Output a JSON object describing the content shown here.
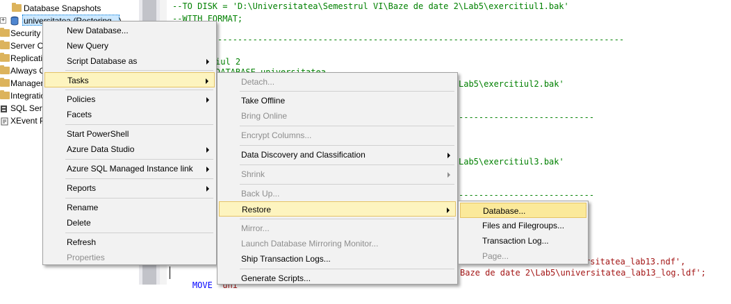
{
  "explorer": {
    "items": [
      {
        "label": "Database Snapshots",
        "kind": "folder",
        "expander": "+"
      },
      {
        "label": "universitatea (Restoring...)",
        "kind": "database",
        "expander": "+"
      },
      {
        "label": "Security",
        "kind": "folder"
      },
      {
        "label": "Server Objects",
        "kind": "folder"
      },
      {
        "label": "Replication",
        "kind": "folder"
      },
      {
        "label": "Always On High Availability",
        "kind": "folder"
      },
      {
        "label": "Management",
        "kind": "folder"
      },
      {
        "label": "Integration Services Catalogs",
        "kind": "folder"
      },
      {
        "label": "SQL Server Agent",
        "kind": "agent",
        "expander": "+"
      },
      {
        "label": "XEvent Profiler",
        "kind": "profiler"
      }
    ]
  },
  "editor": {
    "lines": [
      {
        "text": "--TO DISK = 'D:\\Universitatea\\Semestrul VI\\Baze de date 2\\Lab5\\exercitiul1.bak'",
        "color": "green"
      },
      {
        "text": "--WITH FORMAT;",
        "color": "green"
      },
      {
        "text": "------------------------------------------------------------------------------------------",
        "color": "green"
      },
      {
        "text": "iul 2",
        "color": "green"
      },
      {
        "text": "DATABASE universitatea",
        "color": "green"
      },
      {
        "text": "Lab5\\exercitiul2.bak'",
        "color": "green"
      },
      {
        "text": "---------------------------",
        "color": "green"
      },
      {
        "text": "Lab5\\exercitiul3.bak'",
        "color": "green"
      },
      {
        "text": "---------------------------",
        "color": "green"
      },
      {
        "text": "rsitatea_lab13.ndf',",
        "color": "red"
      },
      {
        "text": "MOVE 'uni",
        "color": "mixed"
      },
      {
        "text": "Baze de date 2\\Lab5\\universitatea_lab13_log.ldf';",
        "color": "red"
      }
    ]
  },
  "menus": {
    "main": [
      {
        "label": "New Database..."
      },
      {
        "label": "New Query"
      },
      {
        "label": "Script Database as",
        "submenu": true
      },
      {
        "sep": true
      },
      {
        "label": "Tasks",
        "submenu": true,
        "highlighted": true
      },
      {
        "sep": true
      },
      {
        "label": "Policies",
        "submenu": true
      },
      {
        "label": "Facets"
      },
      {
        "sep": true
      },
      {
        "label": "Start PowerShell"
      },
      {
        "label": "Azure Data Studio",
        "submenu": true
      },
      {
        "sep": true
      },
      {
        "label": "Azure SQL Managed Instance link",
        "submenu": true
      },
      {
        "sep": true
      },
      {
        "label": "Reports",
        "submenu": true
      },
      {
        "sep": true
      },
      {
        "label": "Rename"
      },
      {
        "label": "Delete"
      },
      {
        "sep": true
      },
      {
        "label": "Refresh"
      },
      {
        "label": "Properties",
        "disabled": true
      }
    ],
    "tasks": [
      {
        "label": "Detach...",
        "disabled": true
      },
      {
        "sep": true
      },
      {
        "label": "Take Offline"
      },
      {
        "label": "Bring Online",
        "disabled": true
      },
      {
        "sep": true
      },
      {
        "label": "Encrypt Columns...",
        "disabled": true
      },
      {
        "sep": true
      },
      {
        "label": "Data Discovery and Classification",
        "submenu": true
      },
      {
        "sep": true
      },
      {
        "label": "Shrink",
        "submenu": true,
        "disabled": true
      },
      {
        "sep": true
      },
      {
        "label": "Back Up...",
        "disabled": true
      },
      {
        "label": "Restore",
        "submenu": true,
        "highlighted": true
      },
      {
        "sep": true
      },
      {
        "label": "Mirror...",
        "disabled": true
      },
      {
        "label": "Launch Database Mirroring Monitor...",
        "disabled": true
      },
      {
        "label": "Ship Transaction Logs..."
      },
      {
        "sep": true
      },
      {
        "label": "Generate Scripts..."
      }
    ],
    "restore": [
      {
        "label": "Database...",
        "highlighted": true
      },
      {
        "label": "Files and Filegroups..."
      },
      {
        "label": "Transaction Log..."
      },
      {
        "label": "Page...",
        "disabled": true
      }
    ]
  }
}
